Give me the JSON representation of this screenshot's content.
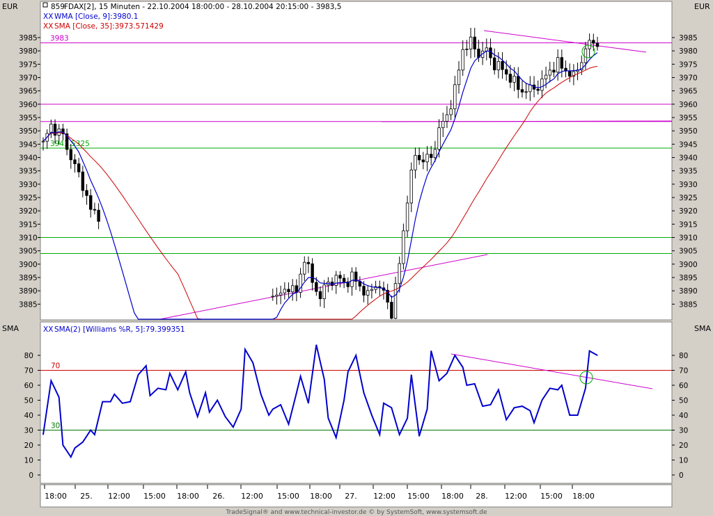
{
  "header": {
    "currency_left": "EUR",
    "currency_right": "EUR",
    "title": "FDAX[2], 15 Minuten - 22.10.2004 18:00:00 - 28.10.2004 20:15:00 - 3983,5",
    "title_prefix": "859"
  },
  "legend": {
    "wma": "WMA [Close, 9]:3980.1",
    "sma": "SMA [Close, 35]:3973.571429"
  },
  "indicator": {
    "label_left": "SMA",
    "label_right": "SMA",
    "legend": "SMA(2) [Williams %R, 5]:79.399351"
  },
  "footer": "TradeSignal® and www.technical-investor.de © by SystemSoft, www.systemsoft.de",
  "colors": {
    "background": "#ffffff",
    "frame": "#d4d0c8",
    "candles": "#000000",
    "wma": "#0000cc",
    "sma": "#cc0000",
    "magenta": "#cc00cc",
    "green": "#00aa00",
    "oscillator": "#0000cc",
    "level70": "#cc0000",
    "level30": "#007700"
  },
  "chart_data": [
    {
      "type": "candlestick",
      "y_ticks": [
        3885,
        3890,
        3895,
        3900,
        3905,
        3910,
        3915,
        3920,
        3925,
        3930,
        3935,
        3940,
        3945,
        3950,
        3955,
        3960,
        3965,
        3970,
        3975,
        3980,
        3985
      ],
      "ylim": [
        3880,
        3987
      ],
      "x_ticks": [
        "18:00",
        "25.",
        "12:00",
        "15:00",
        "18:00",
        "26.",
        "12:00",
        "15:00",
        "18:00",
        "27.",
        "12:00",
        "15:00",
        "18:00",
        "28.",
        "12:00",
        "15:00",
        "18:00"
      ],
      "horizontal_levels": [
        {
          "value": 3983,
          "label": "3983",
          "color": "magenta"
        },
        {
          "value": 3960,
          "label": "",
          "color": "magenta"
        },
        {
          "value": 3953.5,
          "label": "",
          "color": "magenta"
        },
        {
          "value": 3943.5325,
          "label": "3943.5325",
          "color": "green"
        },
        {
          "value": 3910,
          "label": "",
          "color": "green"
        },
        {
          "value": 3904,
          "label": "",
          "color": "green"
        }
      ],
      "series": [
        {
          "name": "WMA [Close, 9]",
          "last": 3980.1
        },
        {
          "name": "SMA [Close, 35]",
          "last": 3973.571429
        }
      ],
      "anchors": [
        {
          "x": 0,
          "y": 3945
        },
        {
          "x": 2,
          "y": 3952
        },
        {
          "x": 5,
          "y": 3948
        },
        {
          "x": 7,
          "y": 3940
        },
        {
          "x": 10,
          "y": 3930
        },
        {
          "x": 12,
          "y": 3920
        },
        {
          "x": 60,
          "y": 3888
        },
        {
          "x": 62,
          "y": 3892
        },
        {
          "x": 64,
          "y": 3889
        },
        {
          "x": 66,
          "y": 3903
        },
        {
          "x": 68,
          "y": 3893
        },
        {
          "x": 70,
          "y": 3888
        },
        {
          "x": 72,
          "y": 3893
        },
        {
          "x": 74,
          "y": 3895
        },
        {
          "x": 76,
          "y": 3893
        },
        {
          "x": 78,
          "y": 3895
        },
        {
          "x": 80,
          "y": 3892
        },
        {
          "x": 82,
          "y": 3888
        },
        {
          "x": 84,
          "y": 3893
        },
        {
          "x": 86,
          "y": 3889
        },
        {
          "x": 88,
          "y": 3882
        },
        {
          "x": 90,
          "y": 3900
        },
        {
          "x": 92,
          "y": 3925
        },
        {
          "x": 94,
          "y": 3941
        },
        {
          "x": 96,
          "y": 3939
        },
        {
          "x": 98,
          "y": 3940
        },
        {
          "x": 100,
          "y": 3950
        },
        {
          "x": 102,
          "y": 3956
        },
        {
          "x": 104,
          "y": 3965
        },
        {
          "x": 106,
          "y": 3981
        },
        {
          "x": 108,
          "y": 3983
        },
        {
          "x": 110,
          "y": 3979
        },
        {
          "x": 112,
          "y": 3980
        },
        {
          "x": 114,
          "y": 3975
        },
        {
          "x": 116,
          "y": 3973
        },
        {
          "x": 118,
          "y": 3970
        },
        {
          "x": 120,
          "y": 3966
        },
        {
          "x": 122,
          "y": 3965
        },
        {
          "x": 124,
          "y": 3966
        },
        {
          "x": 126,
          "y": 3968
        },
        {
          "x": 128,
          "y": 3973
        },
        {
          "x": 130,
          "y": 3975
        },
        {
          "x": 132,
          "y": 3973
        },
        {
          "x": 134,
          "y": 3970
        },
        {
          "x": 136,
          "y": 3977
        },
        {
          "x": 138,
          "y": 3983
        }
      ]
    },
    {
      "type": "line",
      "name": "SMA(2) [Williams %R, 5]",
      "last": 79.399351,
      "y_ticks": [
        0,
        10,
        20,
        30,
        40,
        50,
        60,
        70,
        80
      ],
      "ylim": [
        -3,
        88
      ],
      "levels": [
        {
          "value": 70,
          "label": "70"
        },
        {
          "value": 30,
          "label": "30"
        }
      ],
      "x": [
        0,
        2,
        4,
        5,
        7,
        8,
        10,
        12,
        13,
        15,
        17,
        18,
        20,
        22,
        24,
        26,
        27,
        29,
        31,
        32,
        34,
        36,
        37,
        39,
        41,
        42,
        44,
        46,
        48,
        50,
        51,
        53,
        55,
        57,
        58,
        60,
        62,
        64,
        65,
        67,
        69,
        71,
        72,
        74,
        76,
        77,
        79,
        81,
        83,
        85,
        86,
        88,
        90,
        92,
        93,
        95,
        97,
        98,
        100,
        102,
        104,
        106,
        107,
        109,
        111,
        113,
        115,
        117,
        119,
        121,
        123,
        124,
        126,
        128,
        130,
        131,
        133,
        135,
        137,
        138,
        140
      ],
      "values": [
        27,
        63,
        52,
        20,
        12,
        18,
        22,
        30,
        27,
        49,
        49,
        54,
        48,
        49,
        67,
        73,
        53,
        58,
        57,
        68,
        57,
        69,
        55,
        39,
        55,
        42,
        50,
        39,
        32,
        44,
        84,
        75,
        54,
        40,
        44,
        47,
        34,
        55,
        66,
        48,
        87,
        64,
        38,
        25,
        50,
        69,
        80,
        55,
        40,
        27,
        48,
        45,
        27,
        38,
        67,
        26,
        44,
        83,
        63,
        68,
        80,
        72,
        60,
        61,
        46,
        47,
        57,
        37,
        45,
        46,
        43,
        35,
        50,
        58,
        57,
        60,
        40,
        40,
        58,
        83,
        80
      ]
    }
  ]
}
